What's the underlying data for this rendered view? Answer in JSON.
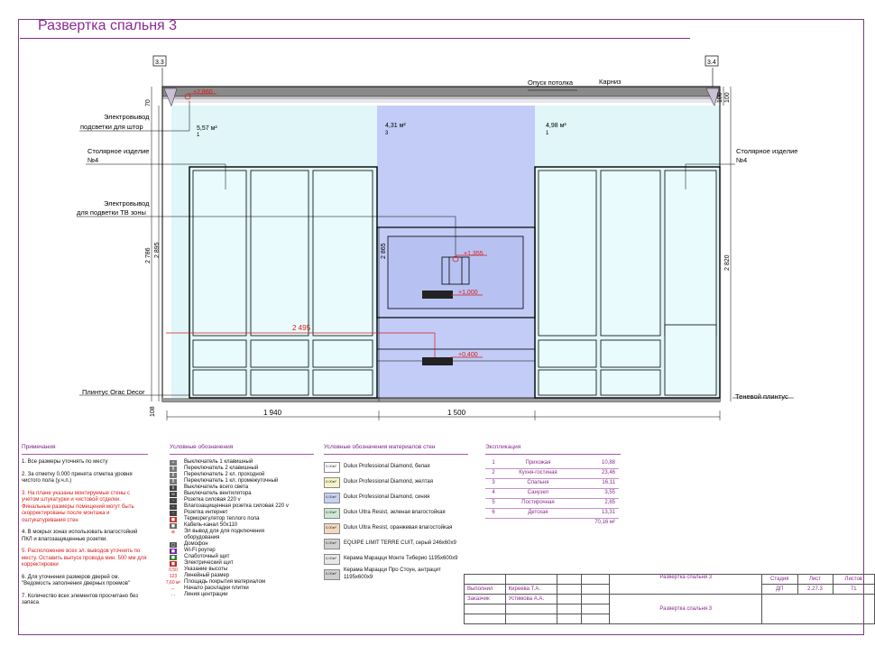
{
  "title": "Развертка спальня 3",
  "drawing": {
    "axis_left": "3.3",
    "axis_right": "3.4",
    "labels": {
      "opusk": "Опуск потолка",
      "karniz": "Карниз",
      "elektro_shtor": "Электровывод",
      "elektro_shtor2": "подсветки для штор",
      "stolyarnoe_left": "Столярное изделие",
      "stolyarnoe_left2": "№4",
      "elektro_tv": "Электровывод",
      "elektro_tv2": "для подветки ТВ зоны",
      "plintus": "Плинтус Orac Decor",
      "stolyarnoe_right": "Столярное изделие",
      "stolyarnoe_right2": "№4",
      "tenevoy": "Теневой плинтус"
    },
    "marks": {
      "m2860": "+2,860",
      "m1355": "+1,355",
      "m1000": "+1,000",
      "m0400": "+0,400"
    },
    "areas": [
      {
        "area": "5,57 м²",
        "num": "1"
      },
      {
        "area": "4,31 м²",
        "num": "3"
      },
      {
        "area": "4,98 м²",
        "num": "1"
      }
    ],
    "dims": {
      "d70": "70",
      "d100": "100",
      "d100b": "100",
      "d2786": "2 786",
      "d2895": "2 895",
      "d2865": "2 865",
      "d2820": "2 820",
      "d108": "108",
      "d2495": "2 495",
      "d1940": "1 940",
      "d1500": "1 500"
    }
  },
  "notes": {
    "header": "Примечания",
    "items": [
      {
        "text": "1. Все размеры уточнять по месту",
        "red": false
      },
      {
        "text": "2. За отметку 0.000 принята отметка уровня чистого пола  (у.ч.п.)",
        "red": false
      },
      {
        "text": "3. На плане указаны монтируемые стены с учетом штукатурки и чистовой отделки. Финальные размеры помещений могут быть скорректированы после монтажа и оштукатуривания стен",
        "red": true
      },
      {
        "text": "4. В мокрых зонах использовать влагостойкий ПКЛ и влагозащищенные розетки.",
        "red": false
      },
      {
        "text": "5. Расположение всех эл. выводов уточнить по месту. Оставить выпуск провода мин. 500 мм для корректировки",
        "red": true
      },
      {
        "text": "6. Для уточнения размеров дверей см. \"Ведомость заполнения дверных проемов\"",
        "red": false
      },
      {
        "text": "7. Количество всех элементов просчитано без запаса",
        "red": false
      }
    ]
  },
  "legend": {
    "header": "Условные обозначения",
    "items": [
      {
        "label": "Выключатель 1 клавишный",
        "color": "#777777",
        "glyph": "▪"
      },
      {
        "label": "Переключатель 2 клавишный",
        "color": "#777777",
        "glyph": "II"
      },
      {
        "label": "Переключатель 2 кл. проходной",
        "color": "#777777",
        "glyph": "II"
      },
      {
        "label": "Переключатель 1 кл. промежуточный",
        "color": "#777777",
        "glyph": "II"
      },
      {
        "label": "Выключатель всего света",
        "color": "#444444",
        "glyph": "х"
      },
      {
        "label": "Выключатель вентилятора",
        "color": "#444444",
        "glyph": "∞"
      },
      {
        "label": "Розетка силовая 220 v",
        "color": "#444444",
        "glyph": "◦"
      },
      {
        "label": "Влагозащищенная розетка силовая 220 v",
        "color": "#444444",
        "glyph": "◦"
      },
      {
        "label": "Розетка интернет",
        "color": "#444444",
        "glyph": "◦"
      },
      {
        "label": "Терморегулятор теплого пола",
        "color": "#c0392b",
        "glyph": "◼"
      },
      {
        "label": "Кабель-канал 50х110",
        "color": "#666666",
        "glyph": "◼"
      },
      {
        "label": "Эл вывод для для подключения",
        "color": "#ffffff",
        "glyph": "⊕"
      },
      {
        "label": "оборудования",
        "color": "#ffffff",
        "glyph": ""
      },
      {
        "label": "Домофон",
        "color": "#555555",
        "glyph": "◻"
      },
      {
        "label": "Wi-Fi роутер",
        "color": "#7b1fa2",
        "glyph": "◼"
      },
      {
        "label": "Слаботочный щит",
        "color": "#2e7d32",
        "glyph": "◼"
      },
      {
        "label": "Электрический щит",
        "color": "#c62828",
        "glyph": "◼"
      },
      {
        "label": "Указание высоты",
        "color": "#ffffff",
        "glyph": "0,50"
      },
      {
        "label": "Линейный размер",
        "color": "#ffffff",
        "glyph": "123"
      },
      {
        "label": "Площадь покрытия материалом",
        "color": "#ffffff",
        "glyph": "7,60 м²"
      },
      {
        "label": "Начало раскладки плитки",
        "color": "#ffffff",
        "glyph": "⌐"
      },
      {
        "label": "Линия центрации",
        "color": "#ffffff",
        "glyph": "- -"
      }
    ]
  },
  "materials": {
    "header": "Условные обозначения материалов стен",
    "items": [
      {
        "label": "Dulux Professional Diamond, белая",
        "sw": "#ffffff",
        "tag": "0,00м²"
      },
      {
        "label": "Dulux Professional Diamond, желтая",
        "sw": "#f7f3c8",
        "tag": "0,00м²"
      },
      {
        "label": "Dulux Professional Diamond, синяя",
        "sw": "#c9d2f2",
        "tag": "0,00м²"
      },
      {
        "label": "Dulux Ultra Resist, зеленая влагостойкая",
        "sw": "#cde8d5",
        "tag": "0,00м²"
      },
      {
        "label": "Dulux Ultra Resist, оранжевая влагостойкая",
        "sw": "#f3d7bf",
        "tag": "0,00м²"
      },
      {
        "label": "EQUIPE LIMIT TERRE CUIT, серый 246х60х9",
        "sw": "#d0d0d0",
        "tag": "0,00м²"
      },
      {
        "label": "Керама Марацци Монте Тиберио 1195х600х9",
        "sw": "#e8e8e8",
        "tag": "0,00м²"
      },
      {
        "label": "Керама Марацци Про Стоун, антрацит 1195х600х9",
        "sw": "#cfcfcf",
        "tag": "0,00м²"
      }
    ]
  },
  "explication": {
    "header": "Экспликация",
    "rows": [
      {
        "n": "1",
        "name": "Прихожая",
        "val": "10,88"
      },
      {
        "n": "2",
        "name": "Кухня-гостиная",
        "val": "23,46"
      },
      {
        "n": "3",
        "name": "Спальня",
        "val": "16,11"
      },
      {
        "n": "4",
        "name": "Санузел",
        "val": "3,55"
      },
      {
        "n": "5",
        "name": "Постирочная",
        "val": "2,85"
      },
      {
        "n": "6",
        "name": "Детская",
        "val": "13,31"
      }
    ],
    "total": "70,16 м²"
  },
  "stamp": {
    "vypolnil_label": "Выполнил",
    "vypolnil": "Киреева Т.А.",
    "zakazchik_label": "Заказчик",
    "zakazchik": "Устимова А.А.",
    "sheet_title": "Развертка спальня 3",
    "sheet_title2": "Развертка спальня 3",
    "stadia_label": "Стадия",
    "list_label": "Лист",
    "listov_label": "Листов",
    "stadia": "ДП",
    "list": "2.27.3",
    "listov": "71"
  }
}
